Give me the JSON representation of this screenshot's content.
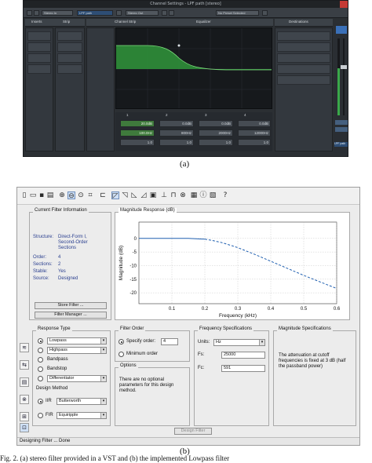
{
  "figure_a": {
    "window_title": "Channel Settings - LPF path [stereo]",
    "toolbar": {
      "preset_btn": "Stereo In",
      "channel_name": "LPF path",
      "output_btn": "Stereo Out",
      "preset_field": "No Preset Selected"
    },
    "tabs": [
      "Inserts",
      "Strip",
      "Channel Strip",
      "Equalizer",
      "Destinations"
    ],
    "eq": {
      "band_numbers": [
        "1",
        "2",
        "3",
        "4"
      ],
      "gain": [
        "20.0dB",
        "0.0dB",
        "0.0dB",
        "0.0dB"
      ],
      "freq": [
        "100.0Hz",
        "800Hz",
        "2000Hz",
        "12000Hz"
      ],
      "q": [
        "1.0",
        "1.0",
        "1.0",
        "1.0"
      ]
    },
    "fader_label": "LPF path",
    "accent": "#3aa84a",
    "caption": "(a)"
  },
  "figure_b": {
    "toolbar_icons": [
      "new-icon",
      "open-icon",
      "save-icon",
      "print-icon",
      "zoom-icon",
      "magnitude-icon",
      "phase-icon",
      "group-delay-icon",
      "impulse-icon",
      "step-icon",
      "pole-zero-icon",
      "coefficients-icon",
      "info-icon",
      "help-icon"
    ],
    "current_filter": {
      "title": "Current Filter Information",
      "rows": [
        {
          "key": "Structure:",
          "value": "Direct-Form I, Second-Order Sections"
        },
        {
          "key": "Order:",
          "value": "4"
        },
        {
          "key": "Sections:",
          "value": "2"
        },
        {
          "key": "Stable:",
          "value": "Yes"
        },
        {
          "key": "Source:",
          "value": "Designed"
        }
      ],
      "store_button": "Store Filter ...",
      "manager_button": "Filter Manager ..."
    },
    "magnitude": {
      "title": "Magnitude Response (dB)"
    },
    "response_type": {
      "title": "Response Type",
      "options": [
        "Lowpass",
        "Highpass",
        "Bandpass",
        "Bandstop",
        "Differentiator"
      ],
      "selected": "Lowpass",
      "design_method_title": "Design Method",
      "iir_label": "IIR",
      "iir_value": "Butterworth",
      "fir_label": "FIR",
      "fir_value": "Equiripple"
    },
    "filter_order": {
      "title": "Filter Order",
      "specify_label": "Specify order:",
      "specify_value": "4",
      "minimum_label": "Minimum order"
    },
    "options": {
      "title": "Options",
      "text": "There are no optional parameters for this design method."
    },
    "frequency_specs": {
      "title": "Frequency Specifications",
      "units_label": "Units:",
      "units_value": "Hz",
      "fs_label": "Fs:",
      "fs_value": "25000",
      "fc_label": "Fc:",
      "fc_value": "591"
    },
    "magnitude_specs": {
      "title": "Magnitude Specifications",
      "text": "The attenuation at cutoff frequencies is fixed at 3 dB (half the passband power)"
    },
    "design_button": "Design Filter",
    "status": "Designing Filter ... Done",
    "caption": "(b)"
  },
  "chart_data": {
    "type": "line",
    "title": "Magnitude Response (dB)",
    "xlabel": "Frequency (kHz)",
    "ylabel": "Magnitude (dB)",
    "xlim": [
      0,
      0.6
    ],
    "ylim": [
      -24,
      6
    ],
    "x_ticks": [
      "0.1",
      "0.2",
      "0.3",
      "0.4",
      "0.5",
      "0.6"
    ],
    "y_ticks": [
      "0",
      "-5",
      "-10",
      "-15",
      "-20"
    ],
    "grid": true,
    "series": [
      {
        "x": [
          0,
          0.05,
          0.1,
          0.15,
          0.2,
          0.22,
          0.25,
          0.28,
          0.3,
          0.35,
          0.4,
          0.45,
          0.5,
          0.55,
          0.6
        ],
        "y": [
          0,
          0,
          0,
          0,
          -0.3,
          -0.7,
          -1.5,
          -2.6,
          -3.4,
          -5.8,
          -8.4,
          -11,
          -13.6,
          -16,
          -18.4
        ]
      }
    ]
  },
  "page_caption": "Fig. 2. (a) stereo filter provided in a VST and (b) the implemented Lowpass filter"
}
